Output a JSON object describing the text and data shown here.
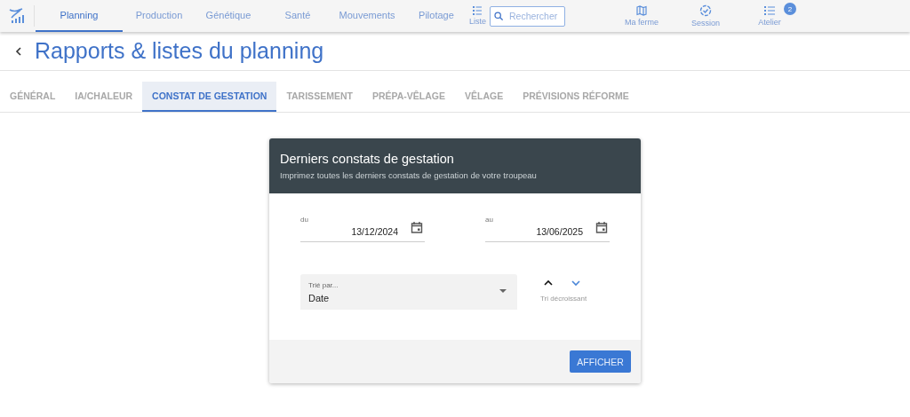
{
  "nav": {
    "items": [
      {
        "label": "Planning",
        "selected": true
      },
      {
        "label": "Production",
        "selected": false
      },
      {
        "label": "Génétique",
        "selected": false
      },
      {
        "label": "Santé",
        "selected": false
      },
      {
        "label": "Mouvements",
        "selected": false
      },
      {
        "label": "Pilotage",
        "selected": false
      }
    ],
    "list_label": "Liste",
    "search": {
      "placeholder": "Rechercher"
    },
    "actions": [
      {
        "kind": "map",
        "label": "Ma ferme"
      },
      {
        "kind": "session",
        "label": "Session"
      },
      {
        "kind": "list",
        "label": "Atelier",
        "badge": "2"
      }
    ]
  },
  "page": {
    "title": "Rapports & listes du planning"
  },
  "tabs": [
    {
      "label": "GÉNÉRAL",
      "selected": false
    },
    {
      "label": "IA/CHALEUR",
      "selected": false
    },
    {
      "label": "CONSTAT DE GESTATION",
      "selected": true
    },
    {
      "label": "TARISSEMENT",
      "selected": false
    },
    {
      "label": "PRÉPA-VÊLAGE",
      "selected": false
    },
    {
      "label": "VÊLAGE",
      "selected": false
    },
    {
      "label": "PRÉVISIONS RÉFORME",
      "selected": false
    }
  ],
  "card": {
    "title": "Derniers constats de gestation",
    "subtitle": "Imprimez toutes les derniers constats de gestation de votre troupeau",
    "dates": [
      {
        "label": "du",
        "value": "13/12/2024"
      },
      {
        "label": "au",
        "value": "13/06/2025"
      }
    ],
    "sort": {
      "label": "Trié par...",
      "value": "Date",
      "directions": [
        {
          "kind": "up",
          "selected": false
        },
        {
          "kind": "down",
          "selected": true
        }
      ],
      "caption": "Tri décroissant"
    },
    "button": "AFFICHER"
  }
}
